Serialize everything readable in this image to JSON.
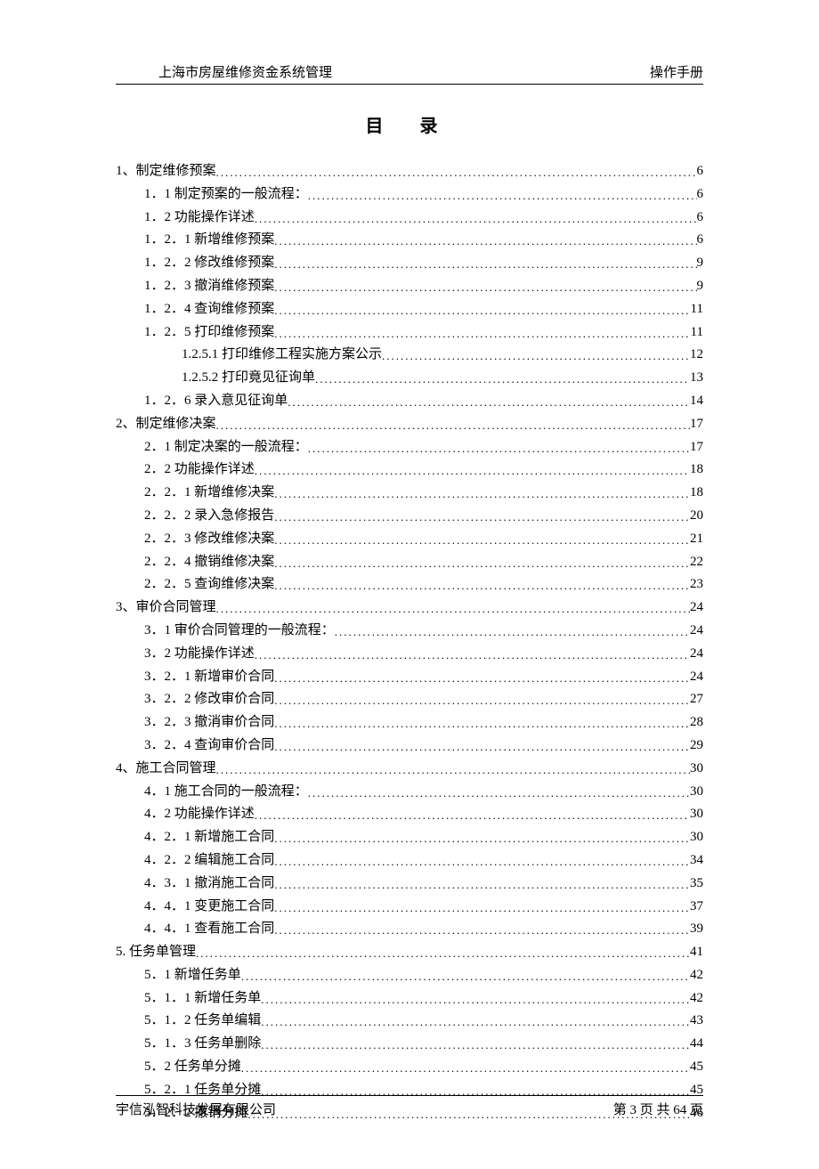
{
  "header": {
    "left": "上海市房屋维修资金系统管理",
    "right": "操作手册"
  },
  "title": "目 录",
  "toc": [
    {
      "level": 0,
      "label": "1、制定维修预案",
      "page": "6"
    },
    {
      "level": 1,
      "label": "1．1 制定预案的一般流程：",
      "page": "6"
    },
    {
      "level": 1,
      "label": "1．2 功能操作详述",
      "page": "6"
    },
    {
      "level": 2,
      "label": "1．2．1 新增维修预案",
      "page": "6"
    },
    {
      "level": 2,
      "label": "1．2．2 修改维修预案",
      "page": "9"
    },
    {
      "level": 2,
      "label": "1．2．3 撤消维修预案",
      "page": "9"
    },
    {
      "level": 2,
      "label": "1．2．4 查询维修预案",
      "page": "11"
    },
    {
      "level": 2,
      "label": "1．2．5 打印维修预案",
      "page": "11"
    },
    {
      "level": 3,
      "label": "1.2.5.1 打印维修工程实施方案公示",
      "page": "12"
    },
    {
      "level": 3,
      "label": "1.2.5.2 打印竟见征询单",
      "page": "13"
    },
    {
      "level": 2,
      "label": "1．2．6 录入意见征询单",
      "page": "14"
    },
    {
      "level": 0,
      "label": "2、制定维修决案",
      "page": "17"
    },
    {
      "level": 1,
      "label": "2．1 制定决案的一般流程：",
      "page": "17"
    },
    {
      "level": 1,
      "label": "2．2 功能操作详述",
      "page": "18"
    },
    {
      "level": 2,
      "label": "2．2．1 新增维修决案",
      "page": "18"
    },
    {
      "level": 2,
      "label": "2．2．2 录入急修报告",
      "page": "20"
    },
    {
      "level": 2,
      "label": "2．2．3 修改维修决案",
      "page": "21"
    },
    {
      "level": 2,
      "label": "2．2．4 撤销维修决案",
      "page": "22"
    },
    {
      "level": 2,
      "label": "2．2．5 查询维修决案",
      "page": "23"
    },
    {
      "level": 0,
      "label": "3、审价合同管理",
      "page": "24"
    },
    {
      "level": 1,
      "label": "3．1 审价合同管理的一般流程：",
      "page": "24"
    },
    {
      "level": 1,
      "label": "3．2 功能操作详述",
      "page": "24"
    },
    {
      "level": 2,
      "label": "3．2．1 新增审价合同",
      "page": "24"
    },
    {
      "level": 2,
      "label": "3．2．2 修改审价合同",
      "page": "27"
    },
    {
      "level": 2,
      "label": "3．2．3 撤消审价合同",
      "page": "28"
    },
    {
      "level": 2,
      "label": "3．2．4 查询审价合同",
      "page": "29"
    },
    {
      "level": 0,
      "label": "4、施工合同管理",
      "page": "30"
    },
    {
      "level": 1,
      "label": "4．1 施工合同的一般流程：",
      "page": "30"
    },
    {
      "level": 1,
      "label": "4．2 功能操作详述",
      "page": "30"
    },
    {
      "level": 2,
      "label": "4．2．1 新增施工合同",
      "page": "30"
    },
    {
      "level": 2,
      "label": "4．2．2 编辑施工合同",
      "page": "34"
    },
    {
      "level": 2,
      "label": "4．3．1 撤消施工合同",
      "page": "35"
    },
    {
      "level": 2,
      "label": "4．4．1 变更施工合同",
      "page": "37"
    },
    {
      "level": 2,
      "label": "4．4．1 查看施工合同",
      "page": "39"
    },
    {
      "level": 0,
      "label": "5.  任务单管理",
      "page": "41"
    },
    {
      "level": 1,
      "label": "5．1 新增任务单",
      "page": "42"
    },
    {
      "level": 2,
      "label": "5．1．1 新增任务单",
      "page": "42"
    },
    {
      "level": 2,
      "label": "5．1．2 任务单编辑",
      "page": "43"
    },
    {
      "level": 2,
      "label": "5．1．3 任务单删除",
      "page": "44"
    },
    {
      "level": 1,
      "label": "5．2 任务单分摊",
      "page": "45"
    },
    {
      "level": 2,
      "label": "5．2．1 任务单分摊",
      "page": "45"
    },
    {
      "level": 2,
      "label": "5．2．2 撤销分摊",
      "page": "46"
    }
  ],
  "footer": {
    "left": "宇信泓智科技发展有限公司",
    "right_prefix": "第 ",
    "right_current": "3",
    "right_mid": " 页  共 ",
    "right_total": "64",
    "right_suffix": " 页"
  }
}
